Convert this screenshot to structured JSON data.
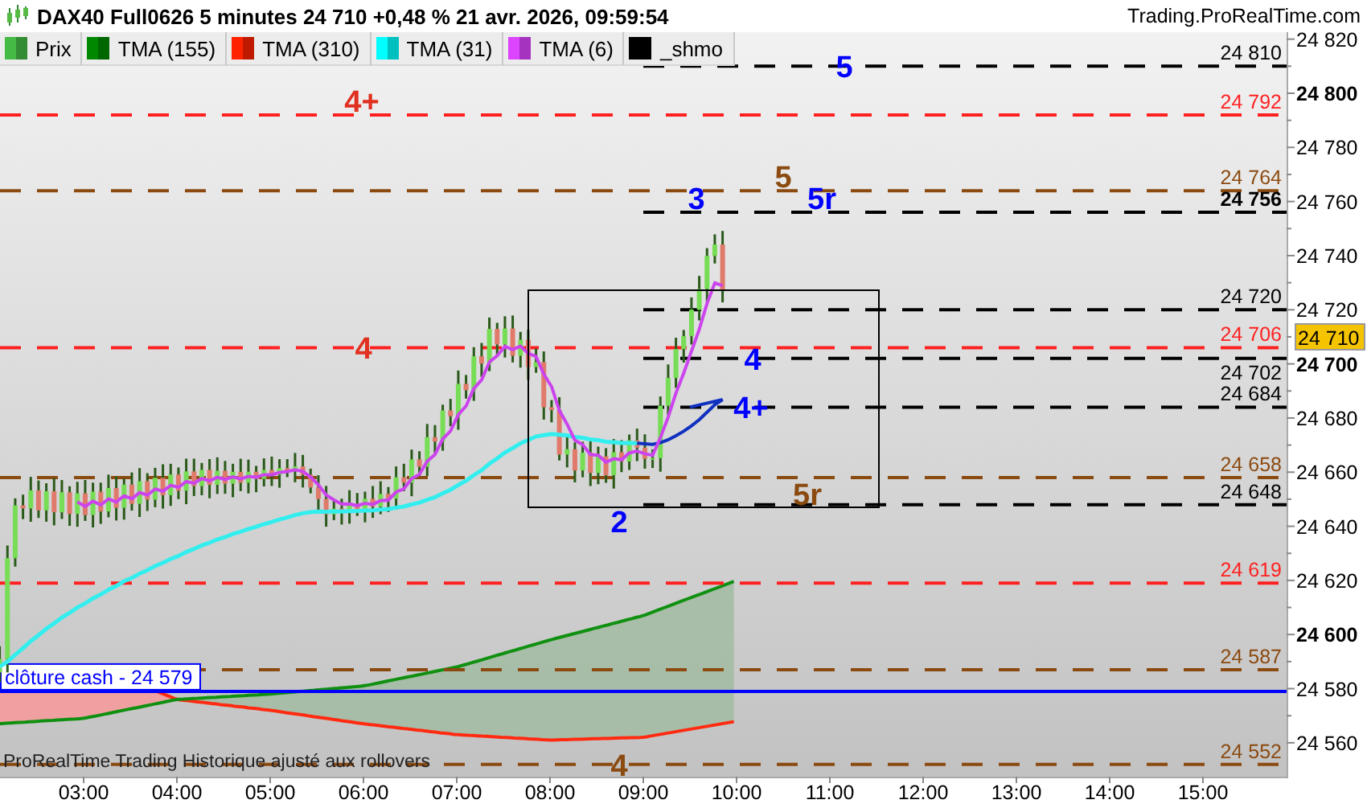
{
  "header": {
    "title": "DAX40 Full0626 5 minutes 24 710 +0,48 % 21 avr. 2026, 09:59:54",
    "site": "Trading.ProRealTime.com"
  },
  "legend": [
    {
      "label": "Prix",
      "color": "#44bb44"
    },
    {
      "label": "TMA (155)",
      "color": "#008800"
    },
    {
      "label": "TMA (310)",
      "color": "#ff2200"
    },
    {
      "label": "TMA (31)",
      "color": "#00ffff"
    },
    {
      "label": "TMA (6)",
      "color": "#dd44ff"
    },
    {
      "label": "_shmo",
      "color": "#000000"
    }
  ],
  "levels": [
    {
      "kind": "short",
      "value": "24 810",
      "color": "#000000",
      "bold": false,
      "markers": [
        {
          "text": "5",
          "color": "#0000ff"
        }
      ]
    },
    {
      "kind": "full",
      "value": "24 792",
      "color": "#ff2020",
      "bold": false,
      "markers": [
        {
          "text": "4+",
          "color": "#e03020"
        }
      ]
    },
    {
      "kind": "full",
      "value": "24 764",
      "color": "#8b4a10",
      "bold": false,
      "markers": [
        {
          "text": "5",
          "color": "#8b4a10"
        }
      ]
    },
    {
      "kind": "short",
      "value": "24 756",
      "color": "#000000",
      "bold": true,
      "markers": [
        {
          "text": "3",
          "color": "#0000ff"
        },
        {
          "text": "5r",
          "color": "#0000ff"
        }
      ]
    },
    {
      "kind": "short",
      "value": "24 720",
      "color": "#000000",
      "bold": false
    },
    {
      "kind": "full",
      "value": "24 706",
      "color": "#ff2020",
      "bold": false,
      "markers": [
        {
          "text": "4",
          "color": "#e03020"
        }
      ]
    },
    {
      "kind": "short",
      "value": "24 702",
      "color": "#000000",
      "bold": false,
      "markers": [
        {
          "text": "4",
          "color": "#0000ff"
        }
      ]
    },
    {
      "kind": "short",
      "value": "24 684",
      "color": "#000000",
      "bold": false,
      "markers": [
        {
          "text": "4+",
          "color": "#0000ff"
        }
      ]
    },
    {
      "kind": "full",
      "value": "24 658",
      "color": "#8b4a10",
      "bold": false,
      "markers": [
        {
          "text": "5r",
          "color": "#8b4a10"
        }
      ]
    },
    {
      "kind": "short",
      "value": "24 648",
      "color": "#000000",
      "bold": false,
      "markers": [
        {
          "text": "2",
          "color": "#0000ff"
        }
      ]
    },
    {
      "kind": "full",
      "value": "24 619",
      "color": "#ff2020",
      "bold": false
    },
    {
      "kind": "full",
      "value": "24 587",
      "color": "#8b4a10",
      "bold": false
    },
    {
      "kind": "tag",
      "label": "clôture cash -",
      "value": "24 579",
      "color": "#0000ff"
    },
    {
      "kind": "full",
      "value": "24 552",
      "color": "#8b4a10",
      "bold": false,
      "markers": [
        {
          "text": "4",
          "color": "#8b4a10"
        }
      ]
    }
  ],
  "y_axis": [
    {
      "label": "24 820",
      "bold": false
    },
    {
      "label": "24 800",
      "bold": true
    },
    {
      "label": "24 780",
      "bold": false
    },
    {
      "label": "24 760",
      "bold": false
    },
    {
      "label": "24 740",
      "bold": false
    },
    {
      "label": "24 720",
      "bold": false
    },
    {
      "label": "24 700",
      "bold": true
    },
    {
      "label": "24 680",
      "bold": false
    },
    {
      "label": "24 660",
      "bold": false
    },
    {
      "label": "24 640",
      "bold": false
    },
    {
      "label": "24 620",
      "bold": false
    },
    {
      "label": "24 600",
      "bold": true
    },
    {
      "label": "24 580",
      "bold": false
    },
    {
      "label": "24 560",
      "bold": false
    }
  ],
  "current_price": "24 710",
  "x_axis": [
    "03:00",
    "04:00",
    "05:00",
    "06:00",
    "07:00",
    "08:00",
    "09:00",
    "10:00",
    "11:00",
    "12:00",
    "13:00",
    "14:00",
    "15:00"
  ],
  "footer": "ProRealTime Trading  Historique ajusté aux rollovers"
}
